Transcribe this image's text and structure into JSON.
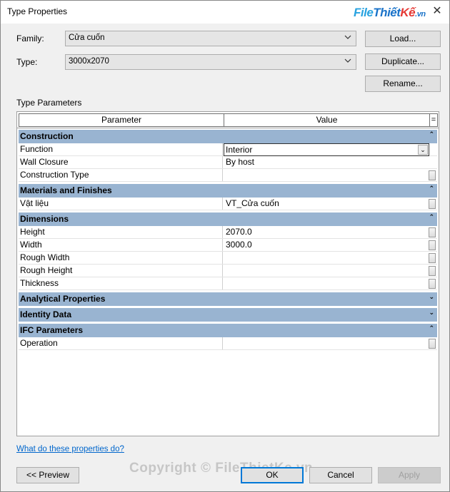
{
  "window": {
    "title": "Type Properties",
    "close_glyph": "✕",
    "logo": {
      "part1": "File",
      "part2": "Thiết",
      "part3": "Kế",
      "part4": ".vn"
    }
  },
  "fields": {
    "family_label": "Family:",
    "family_value": "Cửa cuốn",
    "type_label": "Type:",
    "type_value": "3000x2070"
  },
  "buttons": {
    "load": "Load...",
    "duplicate": "Duplicate...",
    "rename": "Rename...",
    "preview": "<< Preview",
    "ok": "OK",
    "cancel": "Cancel",
    "apply": "Apply"
  },
  "section_label": "Type Parameters",
  "grid": {
    "col_parameter": "Parameter",
    "col_value": "Value",
    "col_menu": "=",
    "groups": [
      {
        "name": "Construction",
        "arrow": "⌃"
      },
      {
        "name": "Materials and Finishes",
        "arrow": "⌃"
      },
      {
        "name": "Dimensions",
        "arrow": "⌃"
      },
      {
        "name": "Analytical Properties",
        "arrow": "⌄"
      },
      {
        "name": "Identity Data",
        "arrow": "⌄"
      },
      {
        "name": "IFC Parameters",
        "arrow": "⌃"
      }
    ],
    "rows": {
      "function": {
        "param": "Function",
        "value": "Interior"
      },
      "wall_closure": {
        "param": "Wall Closure",
        "value": "By host"
      },
      "construction_type": {
        "param": "Construction Type",
        "value": ""
      },
      "vat_lieu": {
        "param": "Vật liệu",
        "value": "VT_Cửa cuốn"
      },
      "height": {
        "param": "Height",
        "value": "2070.0"
      },
      "width": {
        "param": "Width",
        "value": "3000.0"
      },
      "rough_width": {
        "param": "Rough Width",
        "value": ""
      },
      "rough_height": {
        "param": "Rough Height",
        "value": ""
      },
      "thickness": {
        "param": "Thickness",
        "value": ""
      },
      "operation": {
        "param": "Operation",
        "value": ""
      }
    }
  },
  "help_link": "What do these properties do?",
  "watermark": "Copyright © FileThietKe.vn"
}
